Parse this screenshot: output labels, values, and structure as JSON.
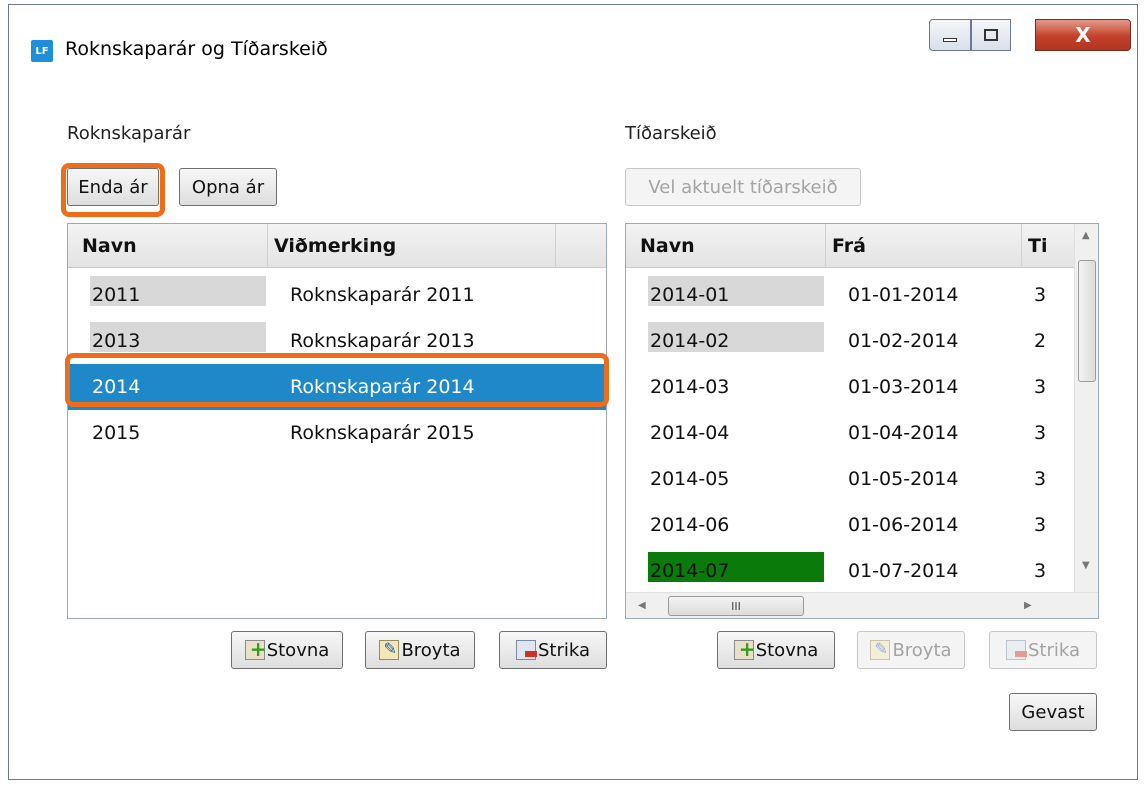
{
  "window": {
    "app_icon": "LF",
    "title": "Roknskaparár og Tíðarskeið",
    "controls": {
      "minimize": "minimize-icon",
      "maximize": "maximize-icon",
      "close": "X"
    }
  },
  "left": {
    "label": "Roknskaparár",
    "buttons": {
      "end_year": "Enda ár",
      "open_year": "Opna ár"
    },
    "columns": [
      "Navn",
      "Viðmerking"
    ],
    "rows": [
      {
        "name": "2011",
        "note": "Roknskaparár 2011"
      },
      {
        "name": "2013",
        "note": "Roknskaparár 2013"
      },
      {
        "name": "2014",
        "note": "Roknskaparár 2014"
      },
      {
        "name": "2015",
        "note": "Roknskaparár 2015"
      }
    ],
    "selected_row": "2014",
    "actions": {
      "create": "Stovna",
      "edit": "Broyta",
      "delete": "Strika"
    }
  },
  "right": {
    "label": "Tíðarskeið",
    "buttons": {
      "set_current": "Vel aktuelt tíðarskeið"
    },
    "columns": [
      "Navn",
      "Frá",
      "Ti"
    ],
    "rows": [
      {
        "name": "2014-01",
        "from": "01-01-2014",
        "to": "3"
      },
      {
        "name": "2014-02",
        "from": "01-02-2014",
        "to": "2"
      },
      {
        "name": "2014-03",
        "from": "01-03-2014",
        "to": "3"
      },
      {
        "name": "2014-04",
        "from": "01-04-2014",
        "to": "3"
      },
      {
        "name": "2014-05",
        "from": "01-05-2014",
        "to": "3"
      },
      {
        "name": "2014-06",
        "from": "01-06-2014",
        "to": "3"
      },
      {
        "name": "2014-07",
        "from": "01-07-2014",
        "to": "3"
      }
    ],
    "actions": {
      "create": "Stovna",
      "edit": "Broyta",
      "delete": "Strika"
    },
    "hscroll_thumb": "III",
    "close": "Gevast"
  },
  "colors": {
    "selection": "#1f88c9",
    "highlight": "#ef6c1a",
    "current_period": "#0a7a0a"
  }
}
